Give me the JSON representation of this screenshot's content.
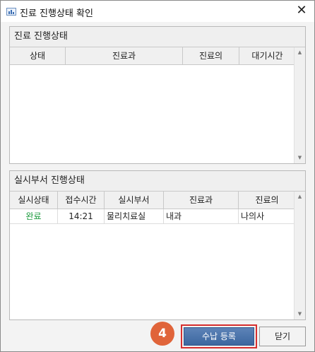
{
  "window": {
    "title": "진료 진행상태 확인",
    "close_glyph": "✕"
  },
  "panel1": {
    "title": "진료 진행상태",
    "columns": [
      "상태",
      "진료과",
      "진료의",
      "대기시간"
    ]
  },
  "panel2": {
    "title": "실시부서 진행상태",
    "columns": [
      "실시상태",
      "접수시간",
      "실시부서",
      "진료과",
      "진료의"
    ],
    "rows": [
      {
        "status": "완료",
        "time": "14:21",
        "dept": "물리치료실",
        "clinic": "내과",
        "doctor": "나의사"
      }
    ]
  },
  "annotation": {
    "step": "4"
  },
  "buttons": {
    "submit": "수납 등록",
    "close": "닫기"
  },
  "colors": {
    "status_done": "#1a9a3c",
    "primary": "#4a72aa",
    "highlight": "#d62f2f",
    "badge": "#e0643a"
  }
}
